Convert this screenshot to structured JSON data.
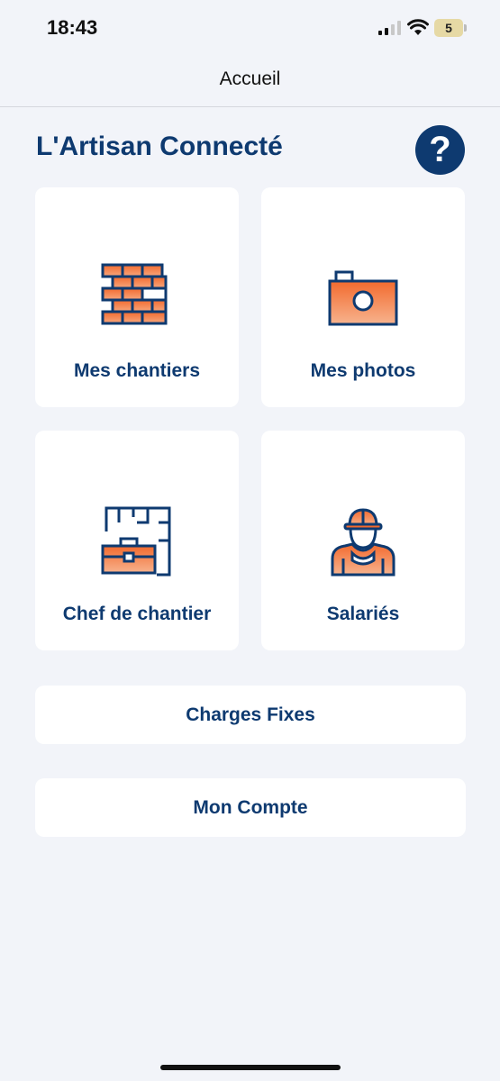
{
  "status_bar": {
    "time": "18:43",
    "battery_level": "5",
    "icons": [
      "signal-icon",
      "wifi-icon",
      "battery-icon"
    ]
  },
  "nav": {
    "title": "Accueil"
  },
  "header": {
    "app_title": "L'Artisan Connecté",
    "help_icon": "question-mark-icon",
    "help_label": "?"
  },
  "tiles": [
    {
      "label": "Mes chantiers",
      "icon": "brick-wall-icon"
    },
    {
      "label": "Mes photos",
      "icon": "camera-icon"
    },
    {
      "label": "Chef de chantier",
      "icon": "blueprint-briefcase-icon"
    },
    {
      "label": "Salariés",
      "icon": "worker-helmet-icon"
    }
  ],
  "buttons": {
    "charges_fixes": "Charges Fixes",
    "mon_compte": "Mon Compte"
  },
  "colors": {
    "primary": "#0e3a70",
    "accent": "#f26a2e",
    "accent_light": "#f7b38e",
    "background": "#f2f4f9",
    "card": "#ffffff"
  }
}
